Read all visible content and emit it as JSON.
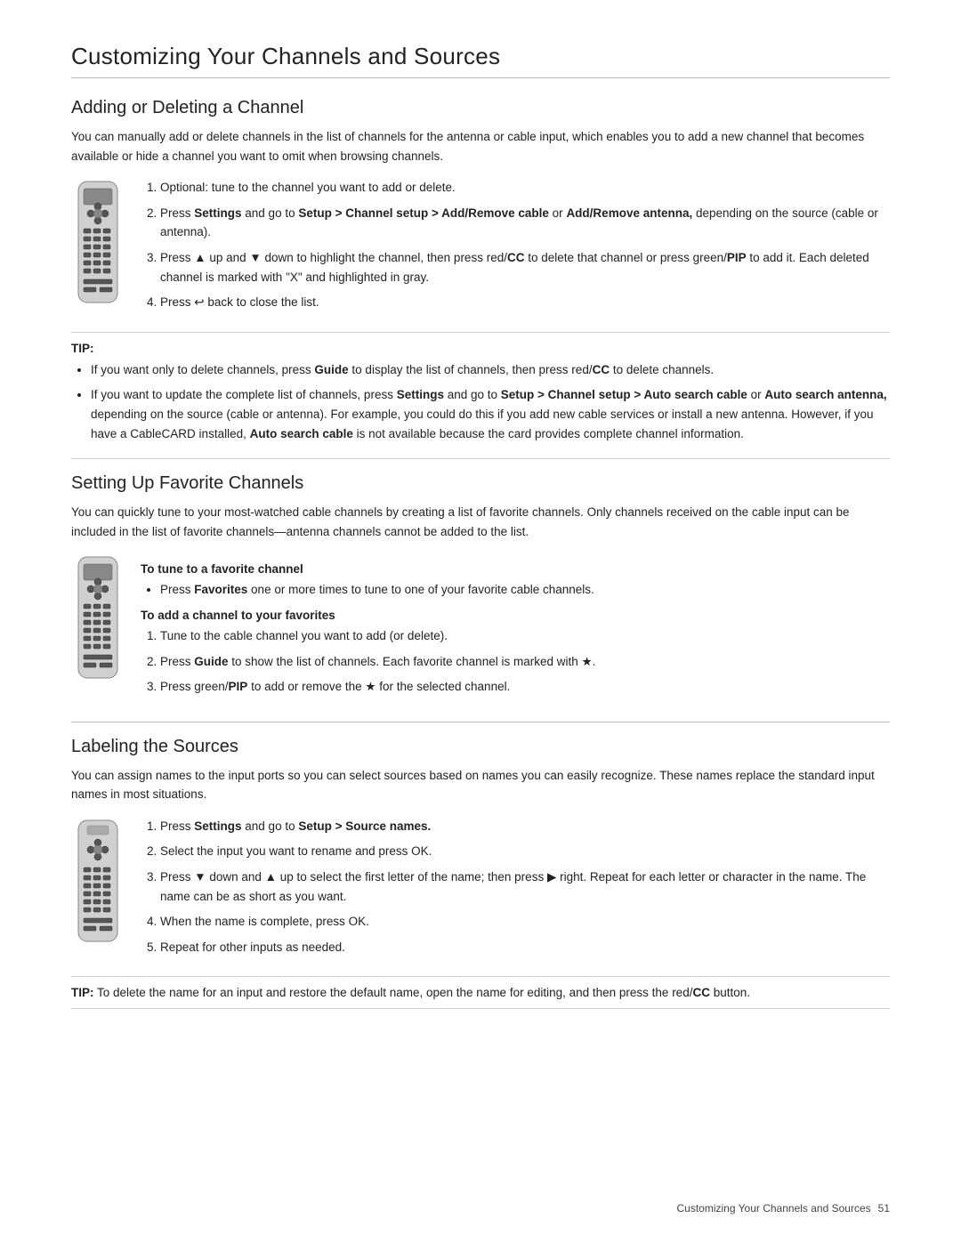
{
  "page": {
    "title": "Customizing Your Channels and Sources",
    "footer_text": "Customizing Your Channels and Sources",
    "footer_page": "51"
  },
  "section1": {
    "title": "Adding or Deleting a Channel",
    "intro": "You can manually add or delete channels in the list of channels for the antenna or cable input, which enables you to add a new channel that becomes available or hide a channel you want to omit when browsing channels.",
    "steps": [
      "Optional: tune to the channel you want to add or delete.",
      "Press Settings and go to Setup > Channel setup > Add/Remove cable or Add/Remove antenna, depending on the source (cable or antenna).",
      "Press ▲ up and ▼ down to highlight the channel, then press red/CC to delete that channel or press green/PIP to add it. Each deleted channel is marked with \"X\" and highlighted in gray.",
      "Press ↩ back to close the list."
    ],
    "tip_label": "TIP:",
    "tip_items": [
      "If you want only to delete channels, press Guide to display the list of channels, then press red/CC to delete channels.",
      "If you want to update the complete list of channels, press Settings and go to Setup > Channel setup > Auto search cable or Auto search antenna, depending on the source (cable or antenna). For example, you could do this if you add new cable services or install a new antenna. However, if you have a CableCARD installed, Auto search cable is not available because the card provides complete channel information."
    ]
  },
  "section2": {
    "title": "Setting Up Favorite Channels",
    "intro": "You can quickly tune to your most-watched cable channels by creating a list of favorite channels. Only channels received on the cable input can be included in the list of favorite channels—antenna channels cannot be added to the list.",
    "subsection1_heading": "To tune to a favorite channel",
    "subsection1_steps": [
      "Press Favorites one or more times to tune to one of your favorite cable channels."
    ],
    "subsection2_heading": "To add a channel to your favorites",
    "subsection2_steps": [
      "Tune to the cable channel you want to add (or delete).",
      "Press Guide to show the list of channels. Each favorite channel is marked with ★.",
      "Press green/PIP to add or remove the ★ for the selected channel."
    ]
  },
  "section3": {
    "title": "Labeling the Sources",
    "intro": "You can assign names to the input ports so you can select sources based on names you can easily recognize. These names replace the standard input names in most situations.",
    "steps": [
      "Press Settings and go to Setup > Source names.",
      "Select the input you want to rename and press OK.",
      "Press ▼ down and ▲ up to select the first letter of the name; then press ▶ right. Repeat for each letter or character in the name. The name can be as short as you want.",
      "When the name is complete, press OK.",
      "Repeat for other inputs as needed."
    ],
    "tip_text": "TIP: To delete the name for an input and restore the default name, open the name for editing, and then press the red/CC button."
  }
}
